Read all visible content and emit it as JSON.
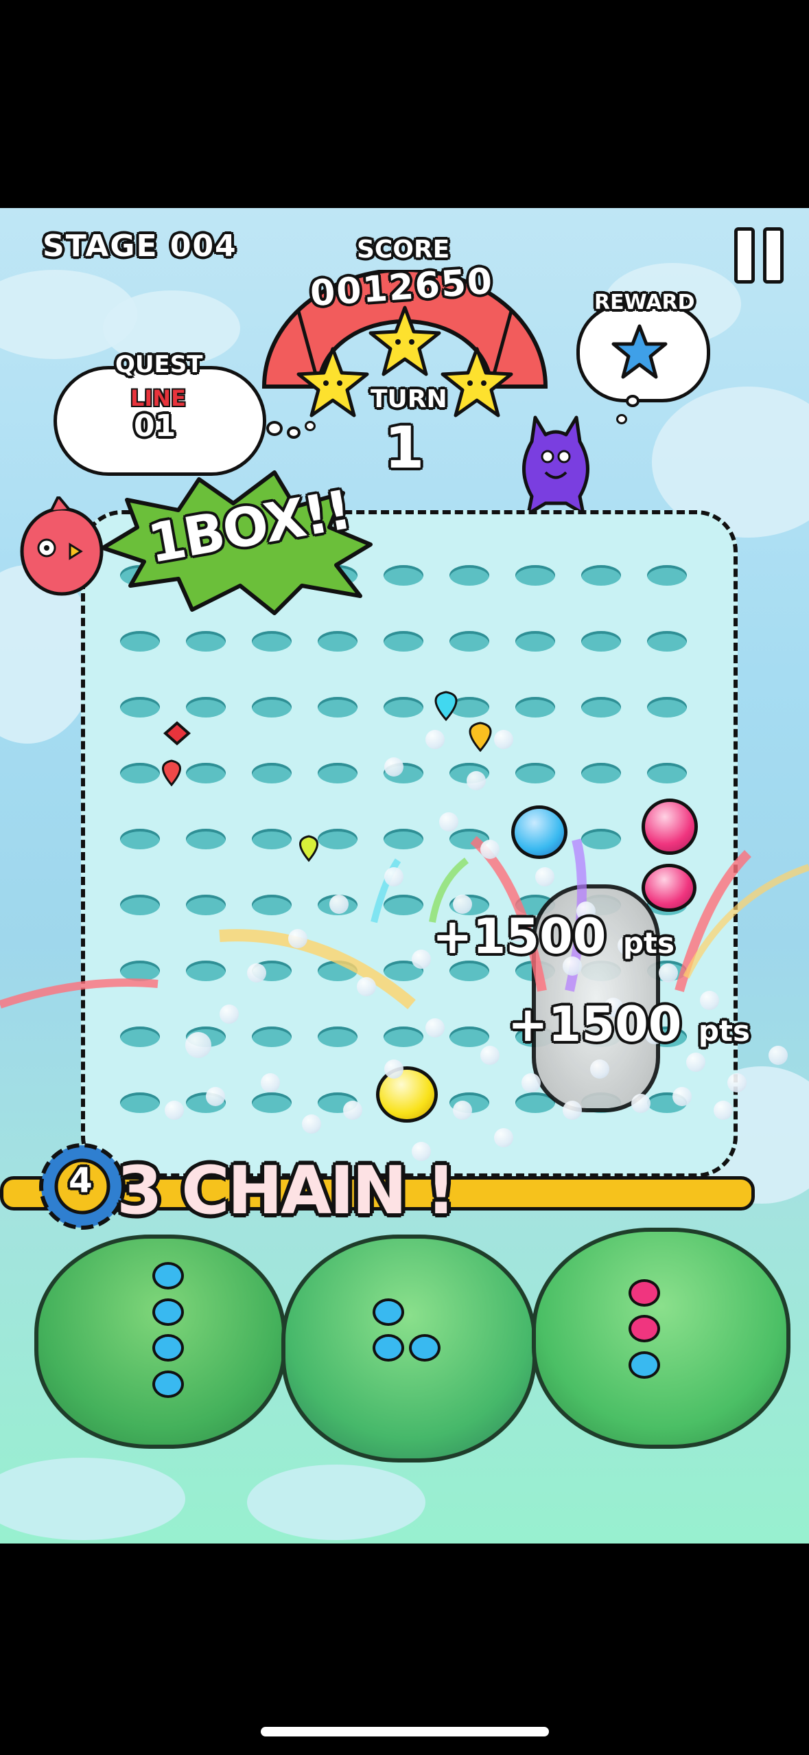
{
  "hud": {
    "stage_label": "STAGE 004",
    "score_label": "SCORE",
    "score_value": "0012650",
    "turn_label": "TURN",
    "turn_value": "1",
    "reward_label": "REWARD",
    "stars_earned": 3
  },
  "quest": {
    "title": "QUEST",
    "type": "LINE",
    "count": "01"
  },
  "banner": {
    "text": "1BOX!!"
  },
  "popups": [
    {
      "amount": "+1500",
      "unit": "pts"
    },
    {
      "amount": "+1500",
      "unit": "pts"
    }
  ],
  "chain": {
    "badge_number": "4",
    "text": "3 CHAIN !"
  },
  "colors": {
    "blue_gem": "#39b9f0",
    "pink_gem": "#f0357f",
    "yellow_gem": "#f9e21a",
    "star": "#fde12e",
    "score_arc": "#f25c5c",
    "bush": "#44b15b"
  },
  "icons": [
    "pause-icon",
    "reward-star-icon",
    "purple-monster-icon",
    "pink-bird-icon"
  ]
}
